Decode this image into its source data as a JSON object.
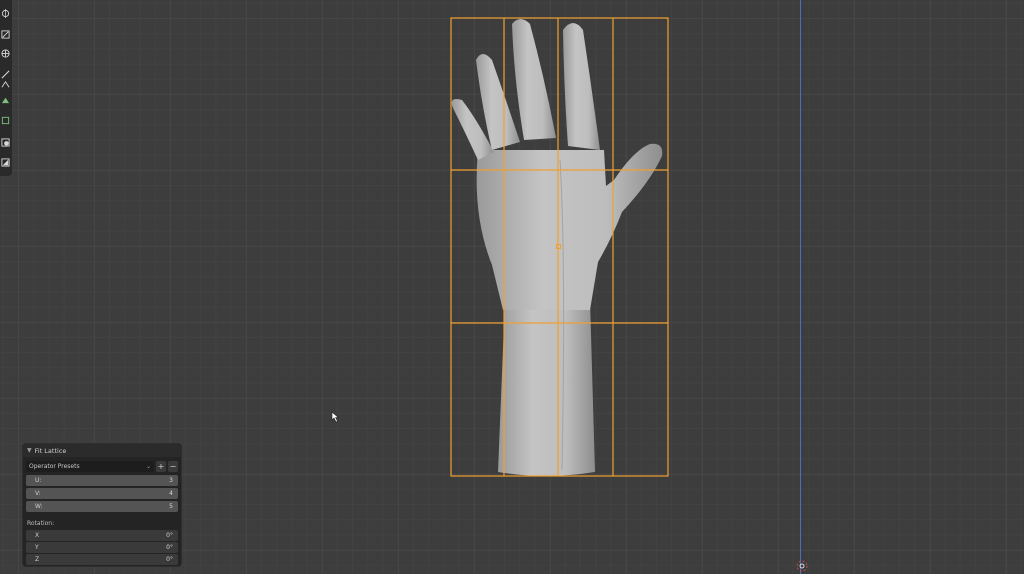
{
  "viewport": {
    "grid_color": "#464646",
    "background": "#3d3d3d",
    "z_axis_color": "#4a6fb8",
    "lattice_color": "#f0a030",
    "mesh_color": "#b4b4b4"
  },
  "toolbar": {
    "tools": [
      "cursor-icon",
      "move-icon",
      "scale-icon",
      "transform-icon",
      "annotate-icon",
      "measure-icon",
      "add-cube-icon",
      "extrude-icon",
      "inset-icon",
      "bevel-icon"
    ]
  },
  "operator_panel": {
    "title": "Fit Lattice",
    "presets_label": "Operator Presets",
    "add_symbol": "+",
    "remove_symbol": "−",
    "fields": [
      {
        "label": "U:",
        "value": "3"
      },
      {
        "label": "V:",
        "value": "4"
      },
      {
        "label": "W:",
        "value": "5"
      }
    ],
    "rotation_label": "Rotation:",
    "rotation": [
      {
        "label": "X",
        "value": "0°"
      },
      {
        "label": "Y",
        "value": "0°"
      },
      {
        "label": "Z",
        "value": "0°"
      }
    ]
  }
}
